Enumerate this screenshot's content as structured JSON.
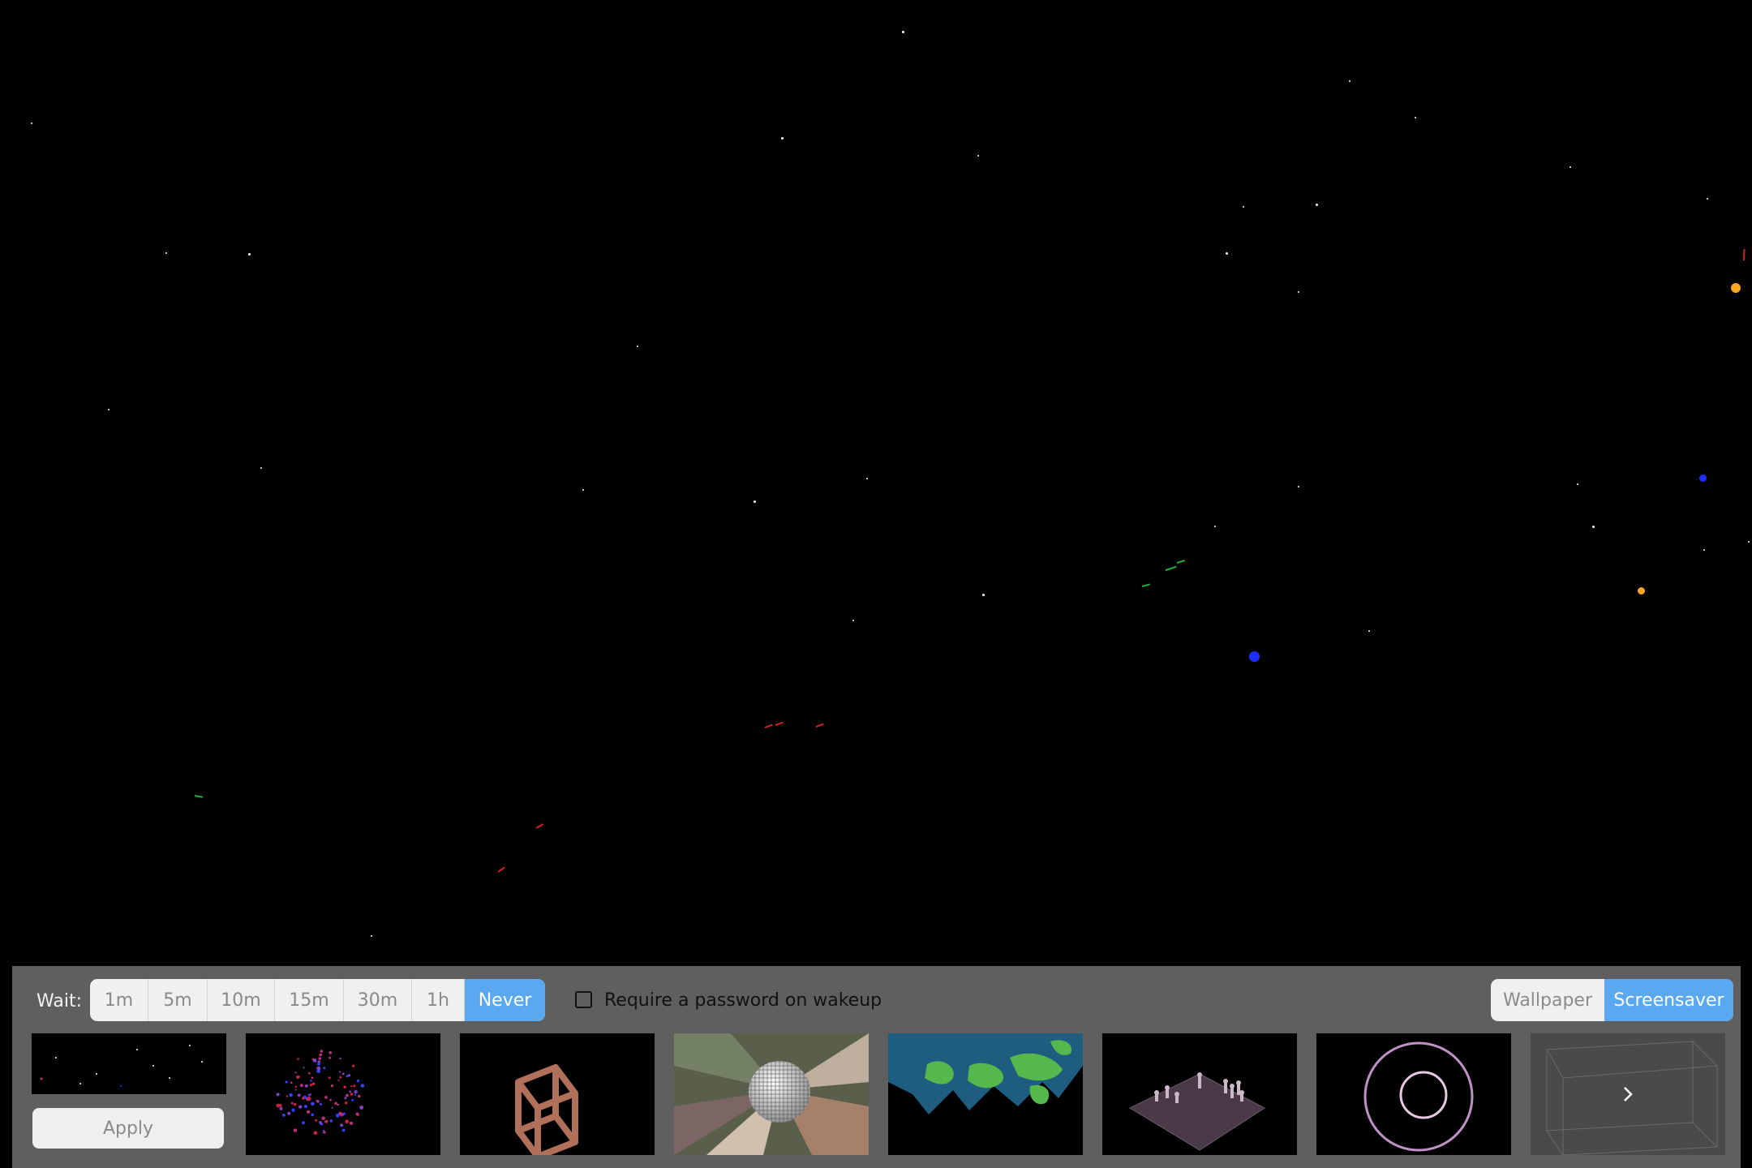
{
  "controls": {
    "wait_label": "Wait:",
    "wait_options": [
      {
        "label": "1m",
        "selected": false
      },
      {
        "label": "5m",
        "selected": false
      },
      {
        "label": "10m",
        "selected": false
      },
      {
        "label": "15m",
        "selected": false
      },
      {
        "label": "30m",
        "selected": false
      },
      {
        "label": "1h",
        "selected": false
      },
      {
        "label": "Never",
        "selected": true
      }
    ],
    "require_password": {
      "label": "Require a password on wakeup",
      "checked": false
    },
    "mode_options": [
      {
        "label": "Wallpaper",
        "selected": false
      },
      {
        "label": "Screensaver",
        "selected": true
      }
    ],
    "apply_label": "Apply"
  },
  "thumbnails": [
    {
      "name": "starfield",
      "selected": true
    },
    {
      "name": "particle-sphere",
      "selected": false
    },
    {
      "name": "wire-cube",
      "selected": false
    },
    {
      "name": "disco-ball",
      "selected": false
    },
    {
      "name": "world-map",
      "selected": false
    },
    {
      "name": "chess-board",
      "selected": false
    },
    {
      "name": "spirograph",
      "selected": false
    },
    {
      "name": "wire-box",
      "selected": false
    }
  ],
  "colors": {
    "accent": "#5aa9f0",
    "panel": "#5f5f5f",
    "background": "#000000"
  },
  "icons": {
    "next": "chevron-right-icon"
  }
}
